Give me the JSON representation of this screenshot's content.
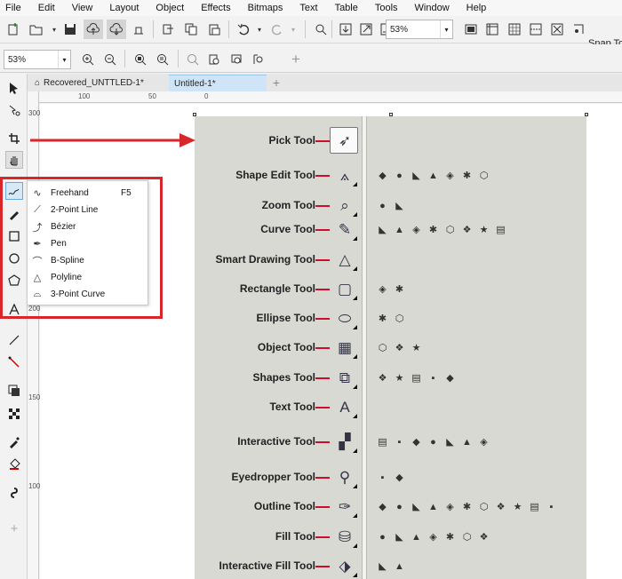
{
  "menu": [
    "File",
    "Edit",
    "View",
    "Layout",
    "Object",
    "Effects",
    "Bitmaps",
    "Text",
    "Table",
    "Tools",
    "Window",
    "Help"
  ],
  "toolbar": {
    "zoom_value": "53%",
    "snap_label": "Snap To",
    "icons": [
      "new-icon",
      "open-icon",
      "save-icon",
      "cloud-upload-icon",
      "cloud-download-icon",
      "print-icon",
      "cut-icon",
      "copy-icon",
      "paste-icon",
      "undo-icon",
      "redo-icon",
      "import-icon",
      "export-icon",
      "publish-icon"
    ]
  },
  "toolbar2": {
    "zoom_value": "53%"
  },
  "tabs": [
    "Recovered_UNTTLED-1*",
    "Untitled-1*"
  ],
  "ruler": {
    "h_labels": [
      "100",
      "50",
      "0"
    ],
    "v_labels": [
      "300",
      "250",
      "200",
      "150",
      "100"
    ]
  },
  "flyout": {
    "items": [
      {
        "label": "Freehand",
        "shortcut": "F5",
        "icon": "freehand-icon"
      },
      {
        "label": "2-Point Line",
        "shortcut": "",
        "icon": "line-icon"
      },
      {
        "label": "Bézier",
        "shortcut": "",
        "icon": "bezier-icon"
      },
      {
        "label": "Pen",
        "shortcut": "",
        "icon": "pen-icon"
      },
      {
        "label": "B-Spline",
        "shortcut": "",
        "icon": "bspline-icon"
      },
      {
        "label": "Polyline",
        "shortcut": "",
        "icon": "polyline-icon"
      },
      {
        "label": "3-Point Curve",
        "shortcut": "",
        "icon": "curve-icon"
      }
    ]
  },
  "figure": {
    "rows": [
      {
        "label": "Pick Tool",
        "subs": 0
      },
      {
        "label": "Shape Edit Tool",
        "subs": 7
      },
      {
        "label": "Zoom Tool",
        "subs": 2
      },
      {
        "label": "Curve Tool",
        "subs": 8
      },
      {
        "label": "Smart Drawing Tool",
        "subs": 0
      },
      {
        "label": "Rectangle Tool",
        "subs": 2
      },
      {
        "label": "Ellipse Tool",
        "subs": 2
      },
      {
        "label": "Object Tool",
        "subs": 3
      },
      {
        "label": "Shapes Tool",
        "subs": 5
      },
      {
        "label": "Text Tool",
        "subs": 0
      },
      {
        "label": "Interactive Tool",
        "subs": 7
      },
      {
        "label": "Eyedropper Tool",
        "subs": 2
      },
      {
        "label": "Outline Tool",
        "subs": 11
      },
      {
        "label": "Fill Tool",
        "subs": 7
      },
      {
        "label": "Interactive Fill Tool",
        "subs": 2
      }
    ]
  }
}
